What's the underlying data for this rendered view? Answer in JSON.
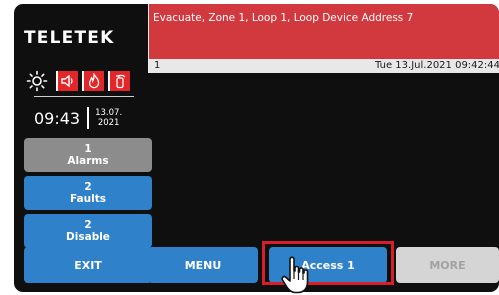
{
  "brand": {
    "name": "TELETEK"
  },
  "status_icons": {
    "icons": [
      "brightness-icon",
      "sounder-icon",
      "fire-icon",
      "extinguisher-icon"
    ],
    "accent_color": "#e3262a"
  },
  "clock": {
    "time": "09:43",
    "date_day_month": "13.07.",
    "date_year": "2021"
  },
  "counters": {
    "alarms": {
      "count": "1",
      "label": "Alarms"
    },
    "faults": {
      "count": "2",
      "label": "Faults"
    },
    "disable": {
      "count": "2",
      "label": "Disable"
    }
  },
  "event": {
    "message": "Evacuate, Zone 1, Loop 1, Loop Device Address 7",
    "index": "1",
    "datetime": "Tue 13.Jul.2021 09:42:44",
    "background_color": "#d1393f"
  },
  "bottom_bar": {
    "exit_label": "EXIT",
    "menu_label": "MENU",
    "access_label": "Access 1",
    "more_label": "MORE"
  },
  "colors": {
    "button_blue": "#2f82c9",
    "button_gray": "#8c8c8c",
    "button_disabled": "#d5d5d5",
    "highlight": "#d61f26"
  }
}
